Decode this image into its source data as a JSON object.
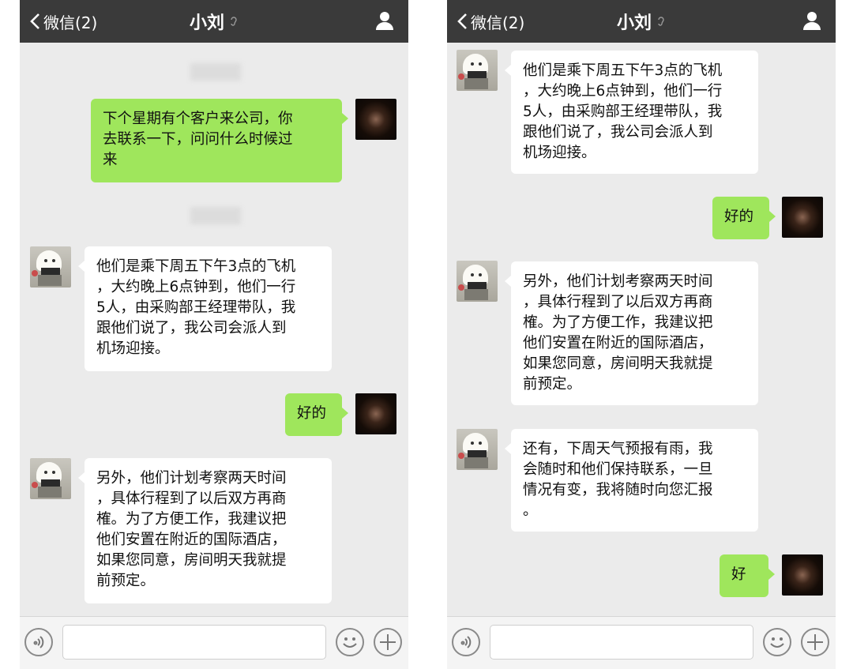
{
  "left_screen": {
    "header": {
      "back_label": "微信(2)",
      "title": "小刘"
    },
    "messages": [
      {
        "side": "me",
        "lines": [
          "下个星期有个客户来公司，你",
          "去联系一下，问问什么时候过",
          "来"
        ]
      },
      {
        "side": "them",
        "lines": [
          "他们是乘下周五下午3点的飞机",
          "，大约晚上6点钟到，他们一行",
          "5人，由采购部王经理带队，我",
          "跟他们说了，我公司会派人到",
          "机场迎接。"
        ]
      },
      {
        "side": "me",
        "lines": [
          "好的"
        ]
      },
      {
        "side": "them",
        "lines": [
          "另外，他们计划考察两天时间",
          "，具体行程到了以后双方再商",
          "榷。为了方便工作，我建议把",
          "他们安置在附近的国际酒店，",
          "如果您同意，房间明天我就提",
          "前预定。"
        ]
      }
    ]
  },
  "right_screen": {
    "header": {
      "back_label": "微信(2)",
      "title": "小刘"
    },
    "messages": [
      {
        "side": "them",
        "lines": [
          "他们是乘下周五下午3点的飞机",
          "，大约晚上6点钟到，他们一行",
          "5人，由采购部王经理带队，我",
          "跟他们说了，我公司会派人到",
          "机场迎接。"
        ]
      },
      {
        "side": "me",
        "lines": [
          "好的"
        ]
      },
      {
        "side": "them",
        "lines": [
          "另外，他们计划考察两天时间",
          "，具体行程到了以后双方再商",
          "榷。为了方便工作，我建议把",
          "他们安置在附近的国际酒店，",
          "如果您同意，房间明天我就提",
          "前预定。"
        ]
      },
      {
        "side": "them",
        "lines": [
          "还有，下周天气预报有雨，我",
          "会随时和他们保持联系，一旦",
          "情况有变，我将随时向您汇报",
          "。"
        ]
      },
      {
        "side": "me",
        "lines": [
          "好"
        ]
      }
    ]
  },
  "icons": [
    "chevron-left-icon",
    "ear-icon",
    "profile-icon",
    "voice-icon",
    "emoji-icon",
    "plus-icon"
  ],
  "colors": {
    "header_bg": "#3a3a3a",
    "chat_bg": "#ebebeb",
    "my_bubble": "#9fe65c",
    "their_bubble": "#ffffff"
  }
}
